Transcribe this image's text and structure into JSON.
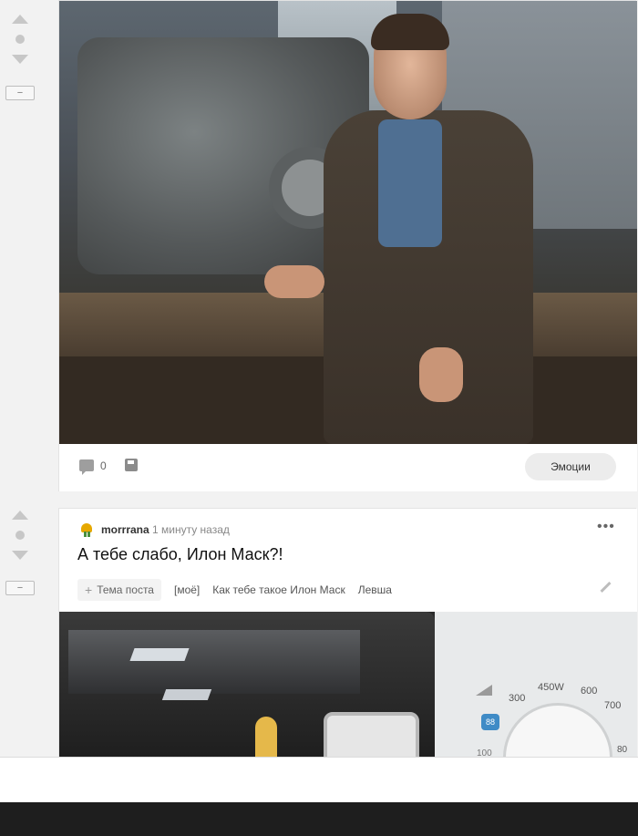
{
  "post1": {
    "image_alt": "Photo of a man in a workshop next to a machine",
    "comments_count": "0",
    "emotions_label": "Эмоции"
  },
  "post2": {
    "author": "morrrana",
    "time": "1 минуту назад",
    "title": "А тебе слабо, Илон Маск?!",
    "tag_topic_label": "Тема поста",
    "tags": [
      "[моё]",
      "Как тебе такое Илон Маск",
      "Левша"
    ],
    "image_alt": "Photo of a washing machine control panel",
    "washer_marks": {
      "m300": "300",
      "m450": "450W",
      "m600": "600",
      "m700": "700",
      "m100": "100",
      "m800": "80"
    }
  },
  "sidebar": {
    "collapse_label": "−"
  },
  "icons": {
    "vote_up": "arrow-up-icon",
    "vote_down": "arrow-down-icon",
    "comment": "comment-icon",
    "save": "save-icon",
    "more": "more-icon",
    "edit": "pencil-icon"
  }
}
